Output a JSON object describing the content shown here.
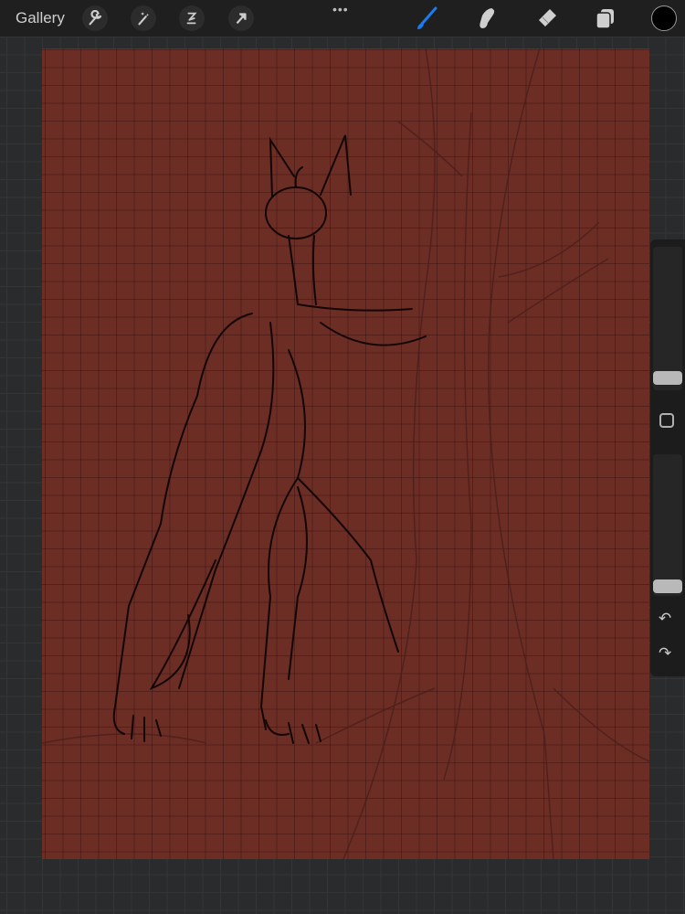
{
  "toolbar": {
    "gallery_label": "Gallery",
    "more_label": "•••",
    "left_tools": [
      "wrench-icon",
      "magic-wand-icon",
      "selection-icon",
      "transform-arrow-icon"
    ],
    "right_tools": [
      "brush-icon",
      "smudge-icon",
      "eraser-icon",
      "layers-icon"
    ],
    "active_tool": "brush",
    "accent_color": "#1a7cf0",
    "current_color": "#000000"
  },
  "sidebar": {
    "brush_size": 0.05,
    "opacity": 0.05,
    "undo": "↶",
    "redo": "↷"
  },
  "canvas": {
    "background_color": "#6c2d25"
  }
}
